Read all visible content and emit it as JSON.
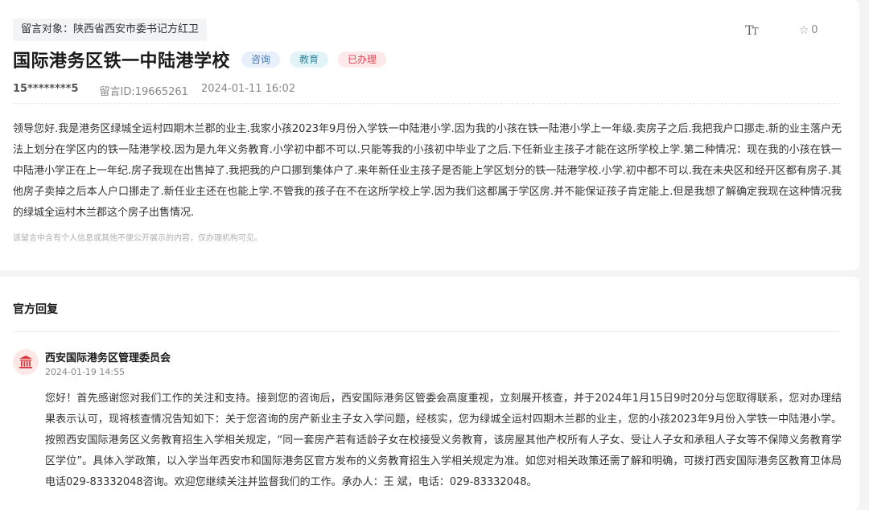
{
  "message": {
    "target": "留言对象：陕西省西安市委书记方红卫",
    "font_size_icon": "font-size-icon",
    "star_count": "0",
    "title": "国际港务区铁一中陆港学校",
    "tags": [
      "咨询",
      "教育",
      "已办理"
    ],
    "phone": "15********5",
    "message_id": "留言ID:19665261",
    "datetime": "2024-01-11 16:02",
    "content": "领导您好.我是港务区绿城全运村四期木兰郡的业主.我家小孩2023年9月份入学铁一中陆港小学.因为我的小孩在铁一陆港小学上一年级.卖房子之后.我把我户口挪走.新的业主落户无法上划分在学区内的铁一陆港学校.因为是九年义务教育.小学初中都不可以.只能等我的小孩初中毕业了之后.下任新业主孩子才能在这所学校上学.第二种情况：现在我的小孩在铁一中陆港小学正在上一年纪.房子我现在出售掉了.我把我的户口挪到集体户了.来年新任业主孩子是否能上学区划分的铁一陆港学校.小学.初中都不可以.我在未央区和经开区都有房子.其他房子卖掉之后本人户口挪走了.新任业主还在也能上学.不管我的孩子在不在这所学校上学.因为我们这都属于学区房.并不能保证孩子肯定能上.但是我想了解确定我现在这种情况我的绿城全运村木兰郡这个房子出售情况.",
    "privacy_notice": "该留言中含有个人信息或其他不便公开展示的内容，仅办理机构可见。"
  },
  "reply": {
    "section_title": "官方回复",
    "org_name": "西安国际港务区管理委员会",
    "datetime": "2024-01-19 14:55",
    "content": "您好！首先感谢您对我们工作的关注和支持。接到您的咨询后，西安国际港务区管委会高度重视，立刻展开核查，并于2024年1月15日9时20分与您取得联系，您对办理结果表示认可，现将核查情况告知如下：关于您咨询的房产新业主子女入学问题，经核实，您为绿城全运村四期木兰郡的业主，您的小孩2023年9月份入学铁一中陆港小学。按照西安国际港务区义务教育招生入学相关规定，“同一套房产若有适龄子女在校接受义务教育，该房屋其他产权所有人子女、受让人子女和承租人子女等不保障义务教育学区学位”。具体入学政策，以入学当年西安市和国际港务区官方发布的义务教育招生入学相关规定为准。如您对相关政策还需了解和明确，可拨打西安国际港务区教育卫体局电话029-83332048咨询。欢迎您继续关注并监督我们的工作。承办人：王 斌，电话：029-83332048。"
  },
  "colors": {
    "tag_consult": "#4b78b2",
    "tag_edu": "#2f8aa3",
    "tag_done": "#e04452",
    "gov_icon": "#d9363e"
  }
}
